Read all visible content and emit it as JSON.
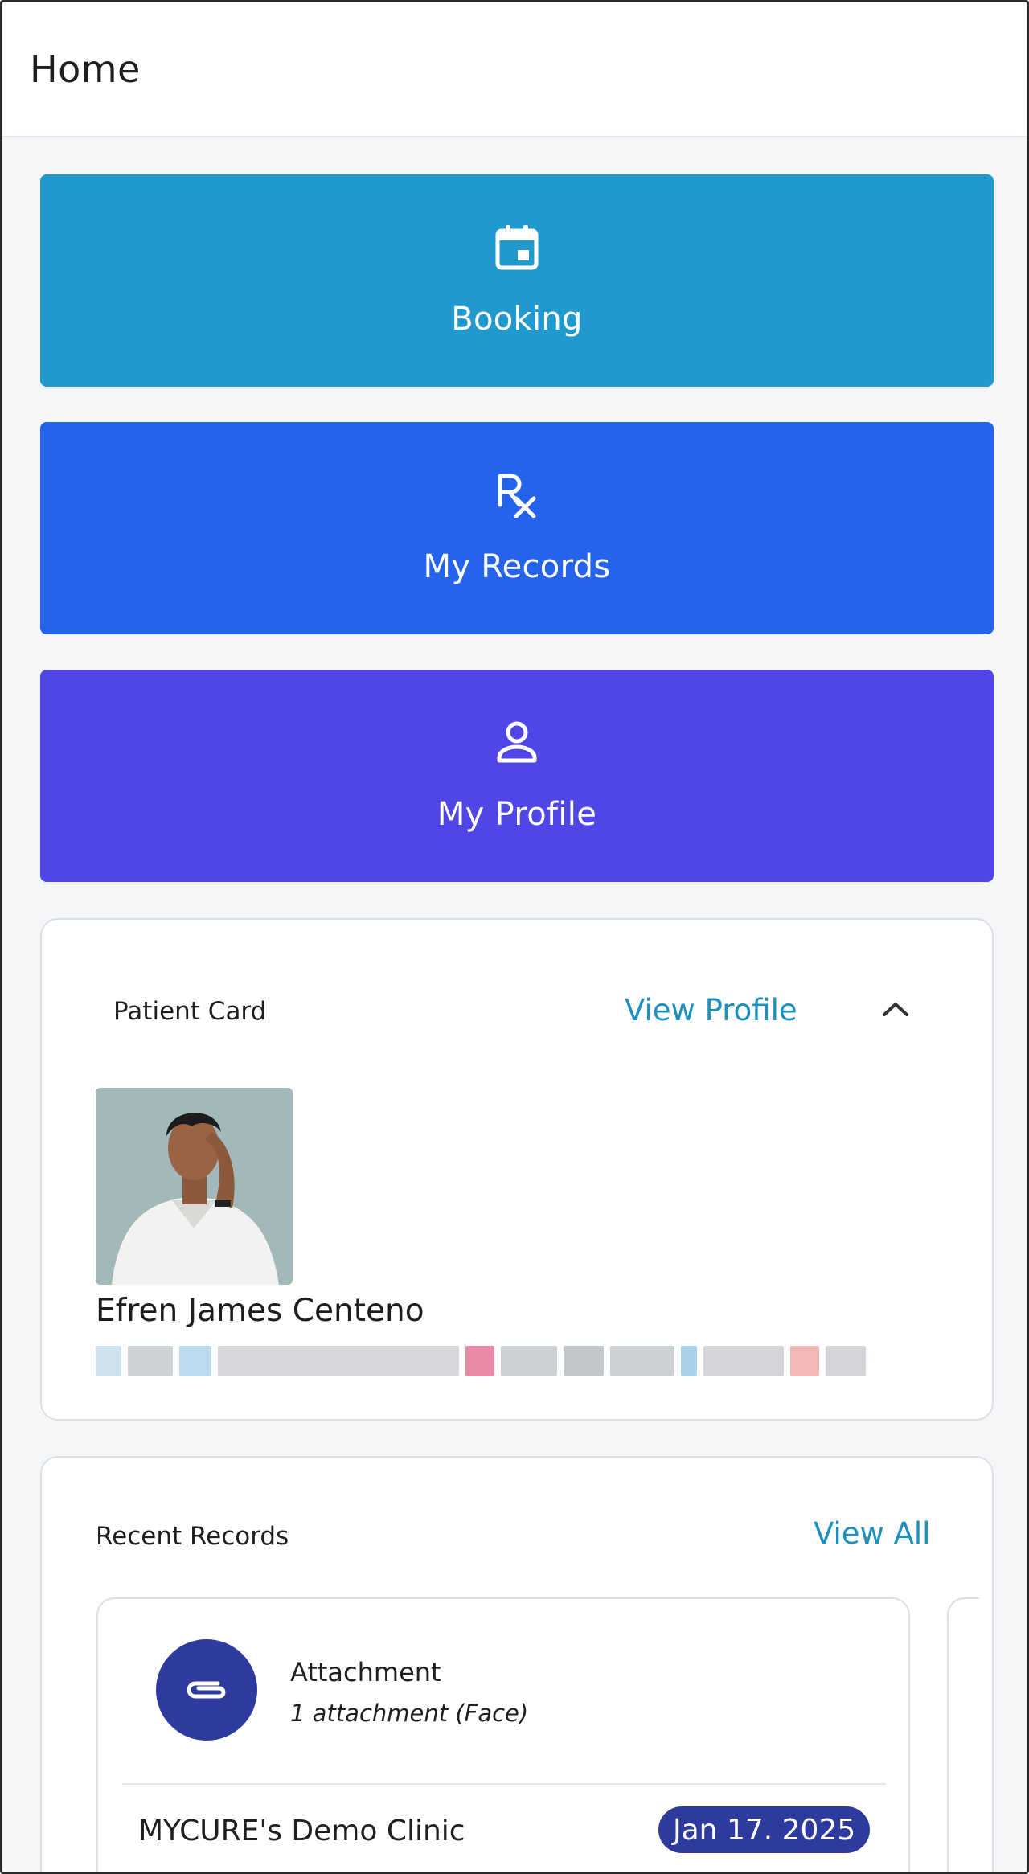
{
  "header": {
    "title": "Home"
  },
  "actions": {
    "booking": {
      "label": "Booking",
      "icon": "calendar-icon",
      "color": "#2299cc"
    },
    "records": {
      "label": "My Records",
      "icon": "rx-icon",
      "color": "#2563eb"
    },
    "profile": {
      "label": "My Profile",
      "icon": "person-icon",
      "color": "#4f46e5"
    }
  },
  "patient_card": {
    "title": "Patient Card",
    "view_profile": "View Profile",
    "name": "Efren James Centeno",
    "collapse_icon": "chevron-up-icon"
  },
  "recent_records": {
    "title": "Recent Records",
    "view_all": "View All",
    "items": [
      {
        "type": "Attachment",
        "subtitle": "1 attachment (Face)",
        "clinic": "MYCURE's Demo Clinic",
        "date": "Jan 17. 2025",
        "icon": "paperclip-icon"
      }
    ]
  },
  "colors": {
    "accent_link": "#1e90bd",
    "record_badge": "#2e3a9e"
  }
}
